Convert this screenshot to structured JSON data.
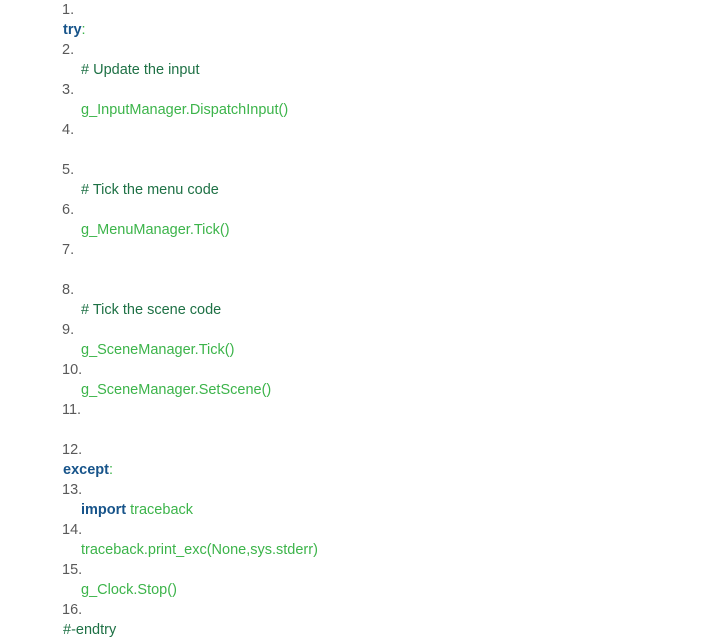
{
  "colors": {
    "background": "#ffffff",
    "line_number": "#595959",
    "keyword": "#17548a",
    "comment": "#1e7145",
    "code": "#3cb44a"
  },
  "code_listing": {
    "steps": [
      {
        "number": "1.",
        "indent": 0,
        "blank": false,
        "tokens": [
          {
            "kind": "keyword",
            "text": "try"
          },
          {
            "kind": "punct",
            "text": ":"
          }
        ]
      },
      {
        "number": "2.",
        "indent": 1,
        "blank": false,
        "tokens": [
          {
            "kind": "comment",
            "text": "# Update the input"
          }
        ]
      },
      {
        "number": "3.",
        "indent": 1,
        "blank": false,
        "tokens": [
          {
            "kind": "code",
            "text": "g_InputManager.DispatchInput()"
          }
        ]
      },
      {
        "number": "4.",
        "indent": 1,
        "blank": true,
        "tokens": []
      },
      {
        "number": "5.",
        "indent": 1,
        "blank": false,
        "tokens": [
          {
            "kind": "comment",
            "text": "# Tick the menu code"
          }
        ]
      },
      {
        "number": "6.",
        "indent": 1,
        "blank": false,
        "tokens": [
          {
            "kind": "code",
            "text": "g_MenuManager.Tick()"
          }
        ]
      },
      {
        "number": "7.",
        "indent": 1,
        "blank": true,
        "tokens": []
      },
      {
        "number": "8.",
        "indent": 1,
        "blank": false,
        "tokens": [
          {
            "kind": "comment",
            "text": "# Tick the scene code"
          }
        ]
      },
      {
        "number": "9.",
        "indent": 1,
        "blank": false,
        "tokens": [
          {
            "kind": "code",
            "text": "g_SceneManager.Tick()"
          }
        ]
      },
      {
        "number": "10.",
        "indent": 1,
        "blank": false,
        "tokens": [
          {
            "kind": "code",
            "text": "g_SceneManager.SetScene()"
          }
        ]
      },
      {
        "number": "11.",
        "indent": 1,
        "blank": true,
        "tokens": []
      },
      {
        "number": "12.",
        "indent": 0,
        "blank": false,
        "tokens": [
          {
            "kind": "keyword",
            "text": "except"
          },
          {
            "kind": "punct",
            "text": ":"
          }
        ]
      },
      {
        "number": "13.",
        "indent": 1,
        "blank": false,
        "tokens": [
          {
            "kind": "keyword",
            "text": "import"
          },
          {
            "kind": "code",
            "text": " traceback"
          }
        ]
      },
      {
        "number": "14.",
        "indent": 1,
        "blank": false,
        "tokens": [
          {
            "kind": "code",
            "text": "traceback.print_exc(None,sys.stderr)"
          }
        ]
      },
      {
        "number": "15.",
        "indent": 1,
        "blank": false,
        "tokens": [
          {
            "kind": "code",
            "text": "g_Clock.Stop()"
          }
        ]
      },
      {
        "number": "16.",
        "indent": 0,
        "blank": false,
        "tokens": [
          {
            "kind": "comment",
            "text": "#-endtry"
          }
        ]
      }
    ]
  }
}
